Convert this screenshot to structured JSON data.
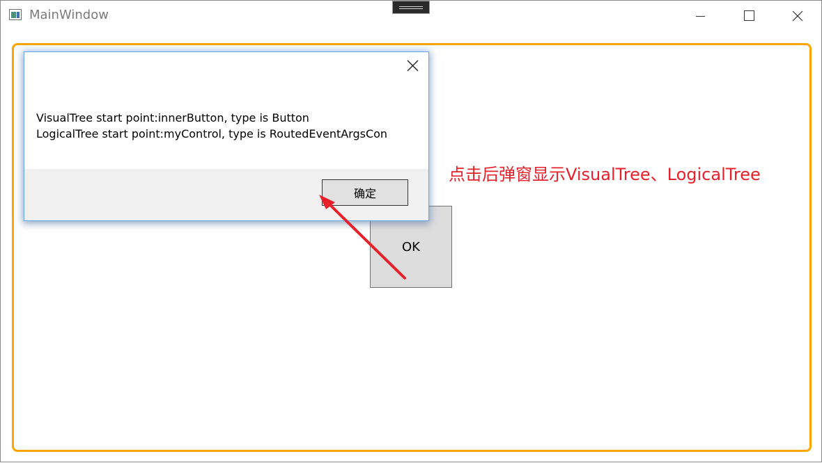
{
  "window": {
    "title": "MainWindow"
  },
  "main": {
    "ok_button_label": "OK",
    "annotation_text": "点击后弹窗显示VisualTree、LogicalTree"
  },
  "dialog": {
    "line1": "VisualTree start point:innerButton, type is Button",
    "line2": "LogicalTree start point:myControl, type is RoutedEventArgsCon",
    "confirm_label": "确定"
  },
  "colors": {
    "frame_border": "#ffa500",
    "annotation": "#e8202a",
    "arrow": "#e8202a"
  },
  "icons": {
    "app": "app-window-icon",
    "minimize": "minimize-icon",
    "maximize": "maximize-icon",
    "close": "close-icon",
    "dialog_close": "dialog-close-icon",
    "arrow": "annotation-arrow"
  }
}
